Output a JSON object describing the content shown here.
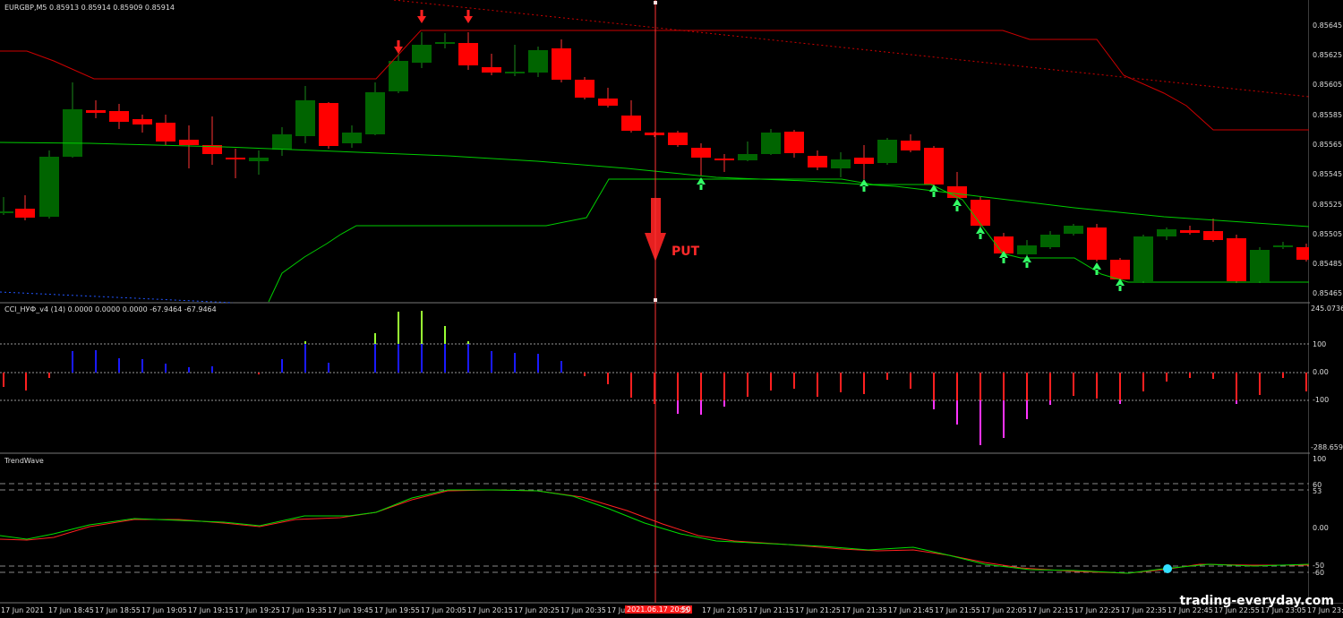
{
  "price_panel": {
    "title": "EURGBP,M5  0.85913 0.85914 0.85909 0.85914",
    "annotation": "PUT",
    "scale": [
      "0.85645",
      "0.85625",
      "0.85605",
      "0.85585",
      "0.85565",
      "0.85545",
      "0.85525",
      "0.85505",
      "0.85485",
      "0.85465"
    ]
  },
  "cci_panel": {
    "title": "CCI_НУФ_v4 (14) 0.0000 0.0000 0.0000 -67.9464 -67.9464",
    "scale": [
      "245.0736",
      "100",
      "0.00",
      "-100",
      "-288.659"
    ]
  },
  "trend_panel": {
    "title": "TrendWave",
    "scale": [
      "100",
      "60",
      "53",
      "0.00",
      "-50",
      "-60"
    ]
  },
  "time_axis": [
    "17 Jun 2021",
    "17 Jun 18:45",
    "17 Jun 18:55",
    "17 Jun 19:05",
    "17 Jun 19:15",
    "17 Jun 19:25",
    "17 Jun 19:35",
    "17 Jun 19:45",
    "17 Jun 19:55",
    "17 Jun 20:05",
    "17 Jun 20:15",
    "17 Jun 20:25",
    "17 Jun 20:35",
    "17 Jun",
    "2021.06.17 20:50",
    "55",
    "17 Jun 21:05",
    "17 Jun 21:15",
    "17 Jun 21:25",
    "17 Jun 21:35",
    "17 Jun 21:45",
    "17 Jun 21:55",
    "17 Jun 22:05",
    "17 Jun 22:15",
    "17 Jun 22:25",
    "17 Jun 22:35",
    "17 Jun 22:45",
    "17 Jun 22:55",
    "17 Jun 23:05",
    "17 Jun 23:1"
  ],
  "watermark": "trading-everyday.com",
  "colors": {
    "bull": "#006400",
    "bear": "#ff0000",
    "ma": "#00cc00",
    "channel_top": "#cc0000",
    "cursor": "#ff3333"
  }
}
